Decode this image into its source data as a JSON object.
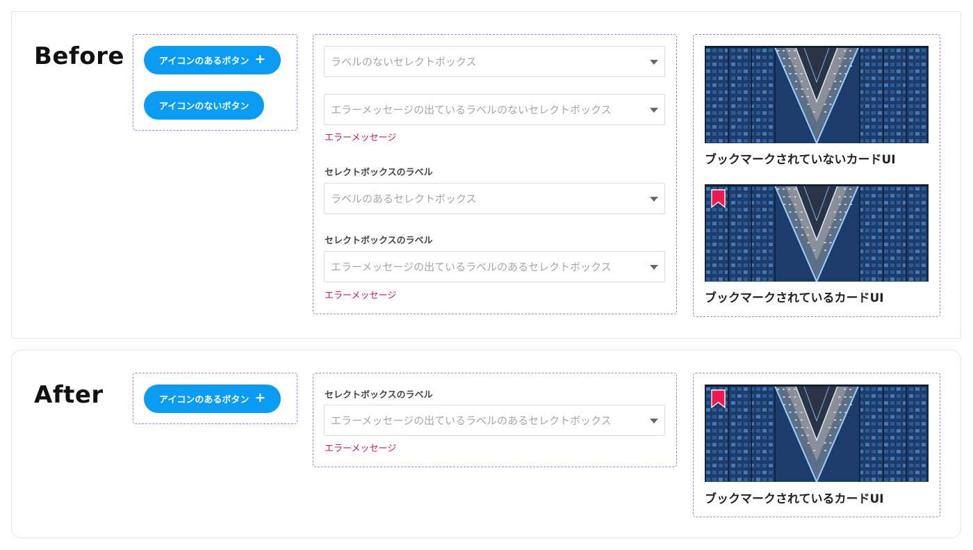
{
  "colors": {
    "accent_button": "#0a9bf2",
    "dashed_outline": "#9d7fe6",
    "error_text": "#c2185b",
    "bookmark": "#f0194f"
  },
  "before": {
    "title": "Before",
    "buttons": {
      "with_icon_label": "アイコンのあるボタン",
      "with_icon_icon": "plus-icon",
      "without_icon_label": "アイコンのないボタン"
    },
    "selects": [
      {
        "label": "",
        "placeholder": "ラベルのないセレクトボックス",
        "error": ""
      },
      {
        "label": "",
        "placeholder": "エラーメッセージの出ているラベルのないセレクトボックス",
        "error": "エラーメッセージ"
      },
      {
        "label": "セレクトボックスのラベル",
        "placeholder": "ラベルのあるセレクトボックス",
        "error": ""
      },
      {
        "label": "セレクトボックスのラベル",
        "placeholder": "エラーメッセージの出ているラベルのあるセレクトボックス",
        "error": "エラーメッセージ"
      }
    ],
    "cards": [
      {
        "title": "ブックマークされていないカードUI",
        "bookmarked": false
      },
      {
        "title": "ブックマークされているカードUI",
        "bookmarked": true
      }
    ]
  },
  "after": {
    "title": "After",
    "buttons": {
      "with_icon_label": "アイコンのあるボタン",
      "with_icon_icon": "plus-icon"
    },
    "select": {
      "label": "セレクトボックスのラベル",
      "placeholder": "エラーメッセージの出ているラベルのあるセレクトボックス",
      "error": "エラーメッセージ"
    },
    "card": {
      "title": "ブックマークされているカードUI",
      "bookmarked": true
    }
  }
}
